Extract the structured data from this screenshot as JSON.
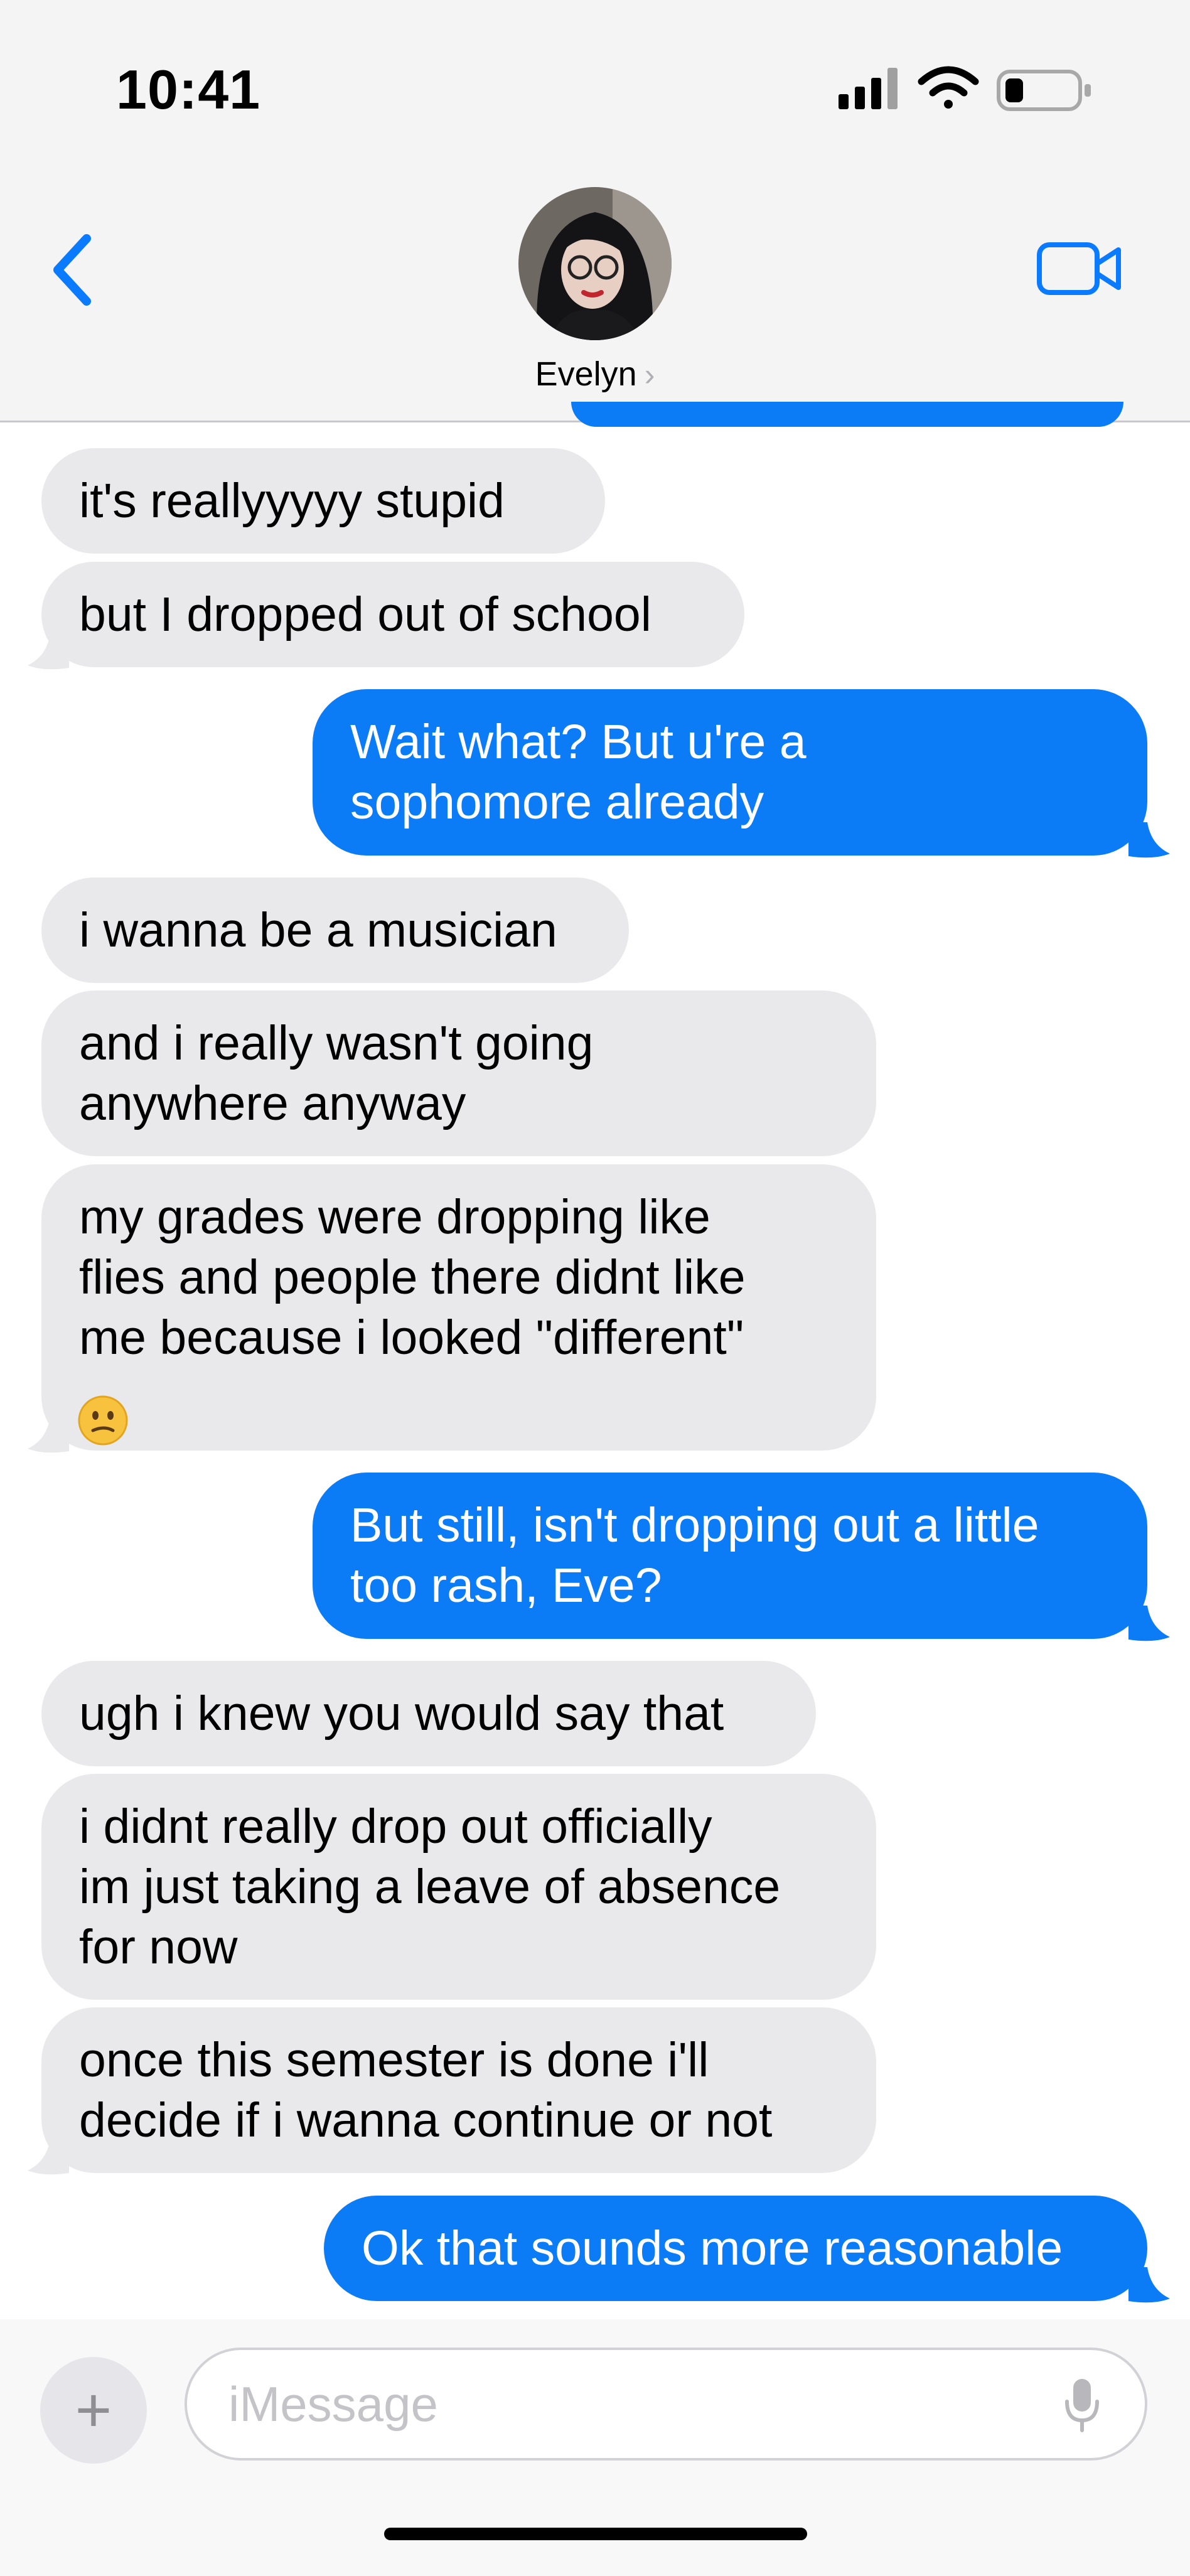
{
  "status_bar": {
    "time": "10:41"
  },
  "header": {
    "contact_name": "Evelyn",
    "chevron": "›"
  },
  "messages": [
    {
      "side": "received",
      "text": "it's reallyyyyy stupid"
    },
    {
      "side": "received",
      "text": "but I dropped out of school"
    },
    {
      "side": "sent",
      "text": "Wait what? But u're a\nsophomore already"
    },
    {
      "side": "received",
      "text": "i wanna be a musician"
    },
    {
      "side": "received",
      "text": "and i really wasn't going\nanywhere anyway"
    },
    {
      "side": "received",
      "text": "my grades were dropping like\nflies and people there didnt like\nme because i looked \"different\""
    },
    {
      "side": "sent",
      "text": "But still, isn't dropping out a little\ntoo rash, Eve?"
    },
    {
      "side": "received",
      "text": "ugh i knew you would say that"
    },
    {
      "side": "received",
      "text": "i didnt really drop out officially\nim just taking a leave of absence\nfor now"
    },
    {
      "side": "received",
      "text": "once this semester is done i'll\ndecide if i wanna continue or not"
    },
    {
      "side": "sent",
      "text": "Ok that sounds more reasonable"
    }
  ],
  "composer": {
    "plus_label": "+",
    "placeholder": "iMessage"
  },
  "colors": {
    "sent_bubble": "#0b7bf6",
    "received_bubble": "#e9e9eb",
    "accent": "#0a7aff"
  },
  "icons": [
    "signal-icon",
    "wifi-icon",
    "battery-icon",
    "back-chevron-icon",
    "video-call-icon",
    "mic-icon",
    "confused-emoji-icon"
  ]
}
